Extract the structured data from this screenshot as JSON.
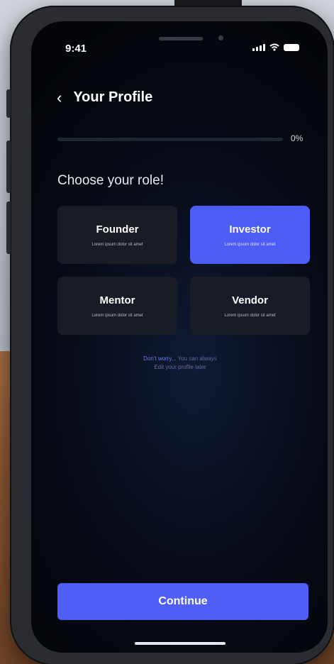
{
  "status_bar": {
    "time": "9:41"
  },
  "header": {
    "back_icon": "chevron-left-icon",
    "title": "Your Profile"
  },
  "progress": {
    "value_percent": 0,
    "label": "0%"
  },
  "prompt": "Choose your role!",
  "roles": [
    {
      "name": "Founder",
      "description": "Lorem ipsum dolor sit amet",
      "selected": false
    },
    {
      "name": "Investor",
      "description": "Lorem ipsum dolor sit amet",
      "selected": true
    },
    {
      "name": "Mentor",
      "description": "Lorem ipsum dolor sit amet",
      "selected": false
    },
    {
      "name": "Vendor",
      "description": "Lorem ipsum dolor sit amet",
      "selected": false
    }
  ],
  "helper": {
    "link": "Don't worry...",
    "line1_rest": " You can always",
    "line2": "Edit your profile later"
  },
  "continue_button": {
    "label": "Continue"
  },
  "colors": {
    "accent": "#4f5ff5",
    "card": "#191c24",
    "screen_bg": "#070b16"
  }
}
